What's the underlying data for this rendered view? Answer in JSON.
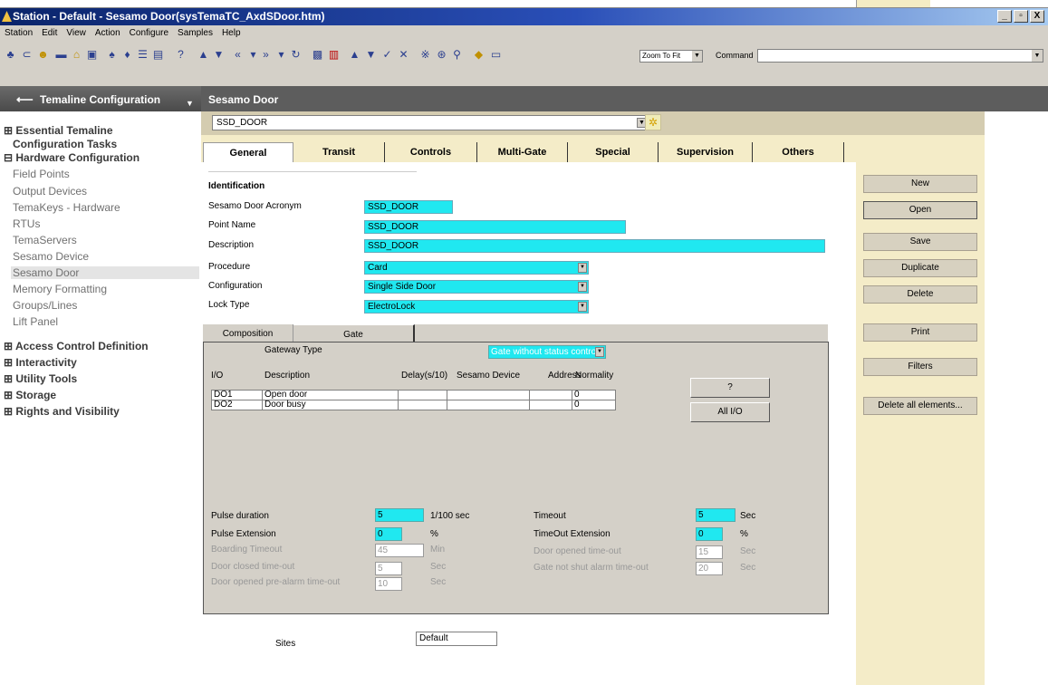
{
  "window": {
    "title": "Station - Default - Sesamo Door(sysTemaTC_AxdSDoor.htm)",
    "buttons": [
      "_",
      "▫",
      "X"
    ]
  },
  "menu": [
    "Station",
    "Edit",
    "View",
    "Action",
    "Configure",
    "Samples",
    "Help"
  ],
  "toolbar": {
    "zoom_value": "Zoom To Fit",
    "command_label": "Command",
    "command_value": ""
  },
  "left": {
    "header": "Temaline Configuration",
    "tree": [
      {
        "type": "section",
        "label": "⊞ Essential Temaline"
      },
      {
        "type": "section",
        "label": "Configuration Tasks"
      },
      {
        "type": "section",
        "label": "⊟ Hardware Configuration"
      },
      {
        "type": "item",
        "label": "Field Points"
      },
      {
        "type": "item",
        "label": "Output Devices"
      },
      {
        "type": "item",
        "label": "TemaKeys - Hardware"
      },
      {
        "type": "item",
        "label": "RTUs"
      },
      {
        "type": "item",
        "label": "TemaServers"
      },
      {
        "type": "item",
        "label": "Sesamo Device"
      },
      {
        "type": "item",
        "label": "Sesamo Door",
        "selected": true
      },
      {
        "type": "item",
        "label": "Memory Formatting"
      },
      {
        "type": "item",
        "label": "Groups/Lines"
      },
      {
        "type": "item",
        "label": "Lift Panel"
      },
      {
        "type": "section",
        "label": "⊞ Access Control Definition"
      },
      {
        "type": "section",
        "label": "⊞ Interactivity"
      },
      {
        "type": "section",
        "label": "⊞ Utility Tools"
      },
      {
        "type": "section",
        "label": "⊞ Storage"
      },
      {
        "type": "section",
        "label": "⊞ Rights and Visibility"
      }
    ]
  },
  "main": {
    "header": "Sesamo Door",
    "selector_value": "SSD_DOOR",
    "tabs": [
      "General",
      "Transit",
      "Controls",
      "Multi-Gate",
      "Special",
      "Supervision",
      "Others"
    ],
    "identification_title": "Identification",
    "fields": {
      "acronym_label": "Sesamo Door Acronym",
      "acronym_value": "SSD_DOOR",
      "point_name_label": "Point Name",
      "point_name_value": "SSD_DOOR",
      "description_label": "Description",
      "description_value": "SSD_DOOR",
      "procedure_label": "Procedure",
      "procedure_value": "Card",
      "configuration_label": "Configuration",
      "configuration_value": "Single Side Door",
      "lock_type_label": "Lock Type",
      "lock_type_value": "ElectroLock"
    },
    "subtabs": [
      "Composition",
      "Gate"
    ],
    "gate": {
      "gateway_type_label": "Gateway Type",
      "gateway_type_value": "Gate without status control",
      "columns": [
        "I/O",
        "Description",
        "Delay(s/10)",
        "Sesamo Device",
        "Address",
        "Normality"
      ],
      "rows": [
        [
          "DO1",
          "Open door",
          "",
          "",
          "",
          "0"
        ],
        [
          "DO2",
          "Door busy",
          "",
          "",
          "",
          "0"
        ]
      ],
      "help_button": "?",
      "all_io_button": "All I/O",
      "pulse_duration_label": "Pulse duration",
      "pulse_duration_value": "5",
      "pulse_duration_unit": "1/100 sec",
      "pulse_extension_label": "Pulse Extension",
      "pulse_extension_value": "0",
      "pulse_extension_unit": "%",
      "boarding_timeout_label": "Boarding Timeout",
      "boarding_timeout_value": "45",
      "boarding_timeout_unit": "Min",
      "door_closed_label": "Door closed time-out",
      "door_closed_value": "5",
      "door_closed_unit": "Sec",
      "prealarm_label": "Door opened pre-alarm time-out",
      "prealarm_value": "10",
      "prealarm_unit": "Sec",
      "timeout_label": "Timeout",
      "timeout_value": "5",
      "timeout_unit": "Sec",
      "timeout_ext_label": "TimeOut Extension",
      "timeout_ext_value": "0",
      "timeout_ext_unit": "%",
      "door_opened_label": "Door opened time-out",
      "door_opened_value": "15",
      "door_opened_unit": "Sec",
      "gate_not_shut_label": "Gate not shut alarm time-out",
      "gate_not_shut_value": "20",
      "gate_not_shut_unit": "Sec"
    },
    "sites_label": "Sites",
    "sites_value": "Default"
  },
  "actions": [
    "New",
    "Open",
    "Save",
    "Duplicate",
    "Delete",
    "Print",
    "Filters",
    "Delete all elements..."
  ]
}
